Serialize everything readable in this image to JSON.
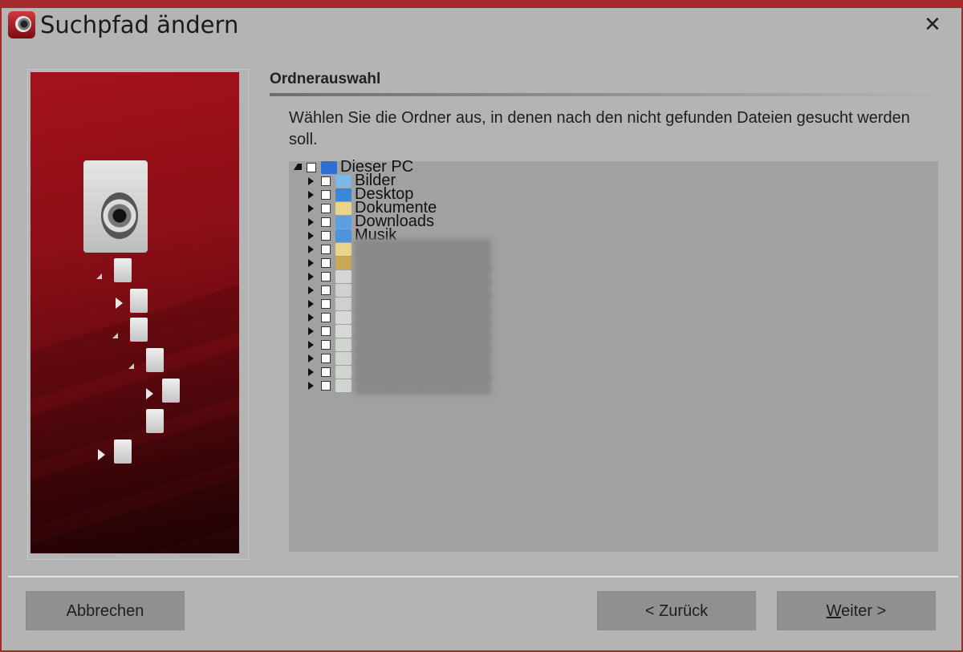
{
  "window": {
    "title": "Suchpfad ändern",
    "close_glyph": "✕",
    "accent_color": "#a42a2e"
  },
  "section": {
    "heading": "Ordnerauswahl",
    "description": "Wählen Sie die Ordner aus, in denen nach den nicht gefunden Dateien gesucht werden soll."
  },
  "tree": {
    "root": {
      "label": "Dieser PC",
      "icon": "computer-icon",
      "expanded": true,
      "checked": false
    },
    "children": [
      {
        "label": "Bilder",
        "icon": "pictures-folder-icon",
        "checked": false,
        "blurred": false
      },
      {
        "label": "Desktop",
        "icon": "desktop-folder-icon",
        "checked": false,
        "blurred": false
      },
      {
        "label": "Dokumente",
        "icon": "documents-folder-icon",
        "checked": false,
        "blurred": false
      },
      {
        "label": "Downloads",
        "icon": "downloads-folder-icon",
        "checked": false,
        "blurred": false
      },
      {
        "label": "Musik",
        "icon": "music-folder-icon",
        "checked": false,
        "blurred": false
      },
      {
        "label": "",
        "icon": "folder-icon",
        "checked": false,
        "blurred": true
      },
      {
        "label": "",
        "icon": "videos-folder-icon",
        "checked": false,
        "blurred": true
      },
      {
        "label": "",
        "icon": "windows-drive-icon",
        "checked": false,
        "blurred": true
      },
      {
        "label": "",
        "icon": "drive-icon",
        "checked": false,
        "blurred": true
      },
      {
        "label": "",
        "icon": "drive-icon",
        "checked": false,
        "blurred": true
      },
      {
        "label": "",
        "icon": "bd-drive-icon",
        "checked": false,
        "blurred": true
      },
      {
        "label": "",
        "icon": "dvd-drive-icon",
        "checked": false,
        "blurred": true
      },
      {
        "label": "",
        "icon": "network-drive-icon",
        "checked": false,
        "blurred": true
      },
      {
        "label": "",
        "icon": "network-drive-icon",
        "checked": false,
        "blurred": true
      },
      {
        "label": "",
        "icon": "network-drive-icon",
        "checked": false,
        "blurred": true
      },
      {
        "label": "",
        "icon": "network-drive-icon",
        "checked": false,
        "blurred": true
      }
    ]
  },
  "buttons": {
    "cancel": "Abbrechen",
    "back": "< Zurück",
    "next_mnemonic": "W",
    "next_rest": "eiter >"
  }
}
